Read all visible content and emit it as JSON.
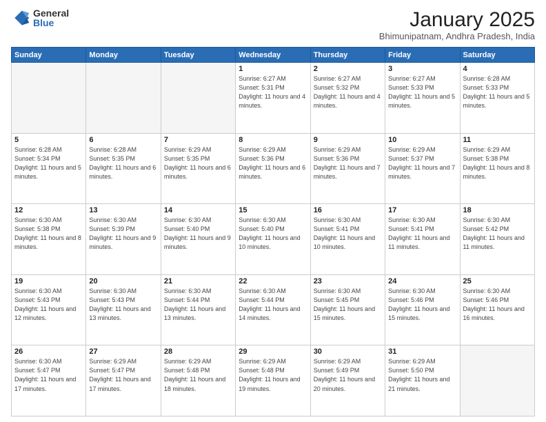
{
  "logo": {
    "general": "General",
    "blue": "Blue"
  },
  "title": "January 2025",
  "location": "Bhimunipatnam, Andhra Pradesh, India",
  "weekdays": [
    "Sunday",
    "Monday",
    "Tuesday",
    "Wednesday",
    "Thursday",
    "Friday",
    "Saturday"
  ],
  "weeks": [
    [
      {
        "day": "",
        "info": ""
      },
      {
        "day": "",
        "info": ""
      },
      {
        "day": "",
        "info": ""
      },
      {
        "day": "1",
        "info": "Sunrise: 6:27 AM\nSunset: 5:31 PM\nDaylight: 11 hours\nand 4 minutes."
      },
      {
        "day": "2",
        "info": "Sunrise: 6:27 AM\nSunset: 5:32 PM\nDaylight: 11 hours\nand 4 minutes."
      },
      {
        "day": "3",
        "info": "Sunrise: 6:27 AM\nSunset: 5:33 PM\nDaylight: 11 hours\nand 5 minutes."
      },
      {
        "day": "4",
        "info": "Sunrise: 6:28 AM\nSunset: 5:33 PM\nDaylight: 11 hours\nand 5 minutes."
      }
    ],
    [
      {
        "day": "5",
        "info": "Sunrise: 6:28 AM\nSunset: 5:34 PM\nDaylight: 11 hours\nand 5 minutes."
      },
      {
        "day": "6",
        "info": "Sunrise: 6:28 AM\nSunset: 5:35 PM\nDaylight: 11 hours\nand 6 minutes."
      },
      {
        "day": "7",
        "info": "Sunrise: 6:29 AM\nSunset: 5:35 PM\nDaylight: 11 hours\nand 6 minutes."
      },
      {
        "day": "8",
        "info": "Sunrise: 6:29 AM\nSunset: 5:36 PM\nDaylight: 11 hours\nand 6 minutes."
      },
      {
        "day": "9",
        "info": "Sunrise: 6:29 AM\nSunset: 5:36 PM\nDaylight: 11 hours\nand 7 minutes."
      },
      {
        "day": "10",
        "info": "Sunrise: 6:29 AM\nSunset: 5:37 PM\nDaylight: 11 hours\nand 7 minutes."
      },
      {
        "day": "11",
        "info": "Sunrise: 6:29 AM\nSunset: 5:38 PM\nDaylight: 11 hours\nand 8 minutes."
      }
    ],
    [
      {
        "day": "12",
        "info": "Sunrise: 6:30 AM\nSunset: 5:38 PM\nDaylight: 11 hours\nand 8 minutes."
      },
      {
        "day": "13",
        "info": "Sunrise: 6:30 AM\nSunset: 5:39 PM\nDaylight: 11 hours\nand 9 minutes."
      },
      {
        "day": "14",
        "info": "Sunrise: 6:30 AM\nSunset: 5:40 PM\nDaylight: 11 hours\nand 9 minutes."
      },
      {
        "day": "15",
        "info": "Sunrise: 6:30 AM\nSunset: 5:40 PM\nDaylight: 11 hours\nand 10 minutes."
      },
      {
        "day": "16",
        "info": "Sunrise: 6:30 AM\nSunset: 5:41 PM\nDaylight: 11 hours\nand 10 minutes."
      },
      {
        "day": "17",
        "info": "Sunrise: 6:30 AM\nSunset: 5:41 PM\nDaylight: 11 hours\nand 11 minutes."
      },
      {
        "day": "18",
        "info": "Sunrise: 6:30 AM\nSunset: 5:42 PM\nDaylight: 11 hours\nand 11 minutes."
      }
    ],
    [
      {
        "day": "19",
        "info": "Sunrise: 6:30 AM\nSunset: 5:43 PM\nDaylight: 11 hours\nand 12 minutes."
      },
      {
        "day": "20",
        "info": "Sunrise: 6:30 AM\nSunset: 5:43 PM\nDaylight: 11 hours\nand 13 minutes."
      },
      {
        "day": "21",
        "info": "Sunrise: 6:30 AM\nSunset: 5:44 PM\nDaylight: 11 hours\nand 13 minutes."
      },
      {
        "day": "22",
        "info": "Sunrise: 6:30 AM\nSunset: 5:44 PM\nDaylight: 11 hours\nand 14 minutes."
      },
      {
        "day": "23",
        "info": "Sunrise: 6:30 AM\nSunset: 5:45 PM\nDaylight: 11 hours\nand 15 minutes."
      },
      {
        "day": "24",
        "info": "Sunrise: 6:30 AM\nSunset: 5:46 PM\nDaylight: 11 hours\nand 15 minutes."
      },
      {
        "day": "25",
        "info": "Sunrise: 6:30 AM\nSunset: 5:46 PM\nDaylight: 11 hours\nand 16 minutes."
      }
    ],
    [
      {
        "day": "26",
        "info": "Sunrise: 6:30 AM\nSunset: 5:47 PM\nDaylight: 11 hours\nand 17 minutes."
      },
      {
        "day": "27",
        "info": "Sunrise: 6:29 AM\nSunset: 5:47 PM\nDaylight: 11 hours\nand 17 minutes."
      },
      {
        "day": "28",
        "info": "Sunrise: 6:29 AM\nSunset: 5:48 PM\nDaylight: 11 hours\nand 18 minutes."
      },
      {
        "day": "29",
        "info": "Sunrise: 6:29 AM\nSunset: 5:48 PM\nDaylight: 11 hours\nand 19 minutes."
      },
      {
        "day": "30",
        "info": "Sunrise: 6:29 AM\nSunset: 5:49 PM\nDaylight: 11 hours\nand 20 minutes."
      },
      {
        "day": "31",
        "info": "Sunrise: 6:29 AM\nSunset: 5:50 PM\nDaylight: 11 hours\nand 21 minutes."
      },
      {
        "day": "",
        "info": ""
      }
    ]
  ]
}
